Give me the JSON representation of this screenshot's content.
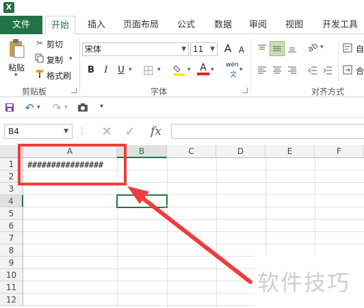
{
  "app": {
    "icon_label": "X"
  },
  "tabs": [
    {
      "label": "文件"
    },
    {
      "label": "开始"
    },
    {
      "label": "插入"
    },
    {
      "label": "页面布局"
    },
    {
      "label": "公式"
    },
    {
      "label": "数据"
    },
    {
      "label": "审阅"
    },
    {
      "label": "视图"
    },
    {
      "label": "开发工具"
    }
  ],
  "ribbon": {
    "clipboard": {
      "paste": "粘贴",
      "cut": "剪切",
      "copy": "复制",
      "format_painter": "格式刷",
      "group_label": "剪贴板"
    },
    "font": {
      "font_name": "宋体",
      "font_size": "11",
      "bold": "B",
      "italic": "I",
      "underline": "U",
      "grow": "A",
      "shrink": "A",
      "font_color": "A",
      "wen": "wén",
      "group_label": "字体"
    },
    "align": {
      "group_label": "对齐方式",
      "wrap_label": "自",
      "merge_label": "合"
    }
  },
  "formula_bar": {
    "name_box": "B4",
    "fx": "fx",
    "value": ""
  },
  "sheet": {
    "columns": [
      "A",
      "B",
      "C",
      "D",
      "E",
      "F"
    ],
    "rows": [
      "1",
      "2",
      "3",
      "4",
      "5",
      "6",
      "7",
      "8",
      "9",
      "10",
      "11",
      "12"
    ],
    "selected_column": "B",
    "selected_row": "4",
    "cells": {
      "A1": "################"
    }
  },
  "watermark": "软件技巧",
  "colors": {
    "excel_green": "#217346",
    "annotation_red": "#f03c3c"
  }
}
